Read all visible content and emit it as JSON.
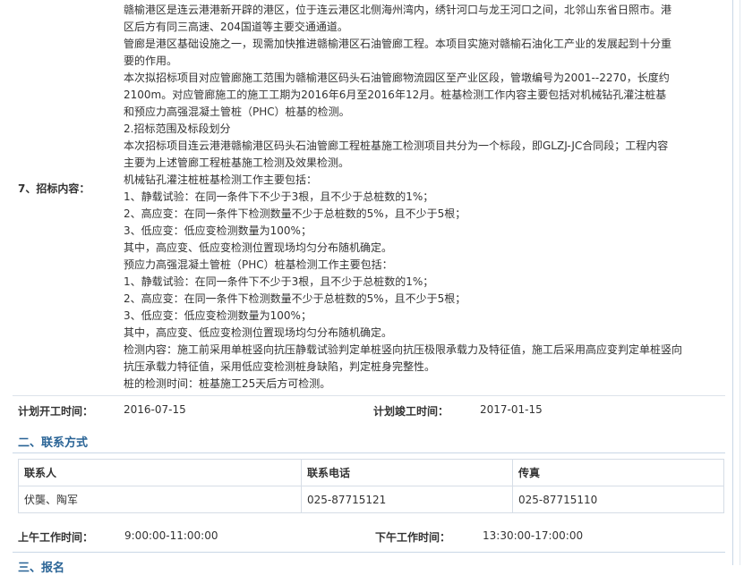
{
  "content": {
    "label": "7、招标内容：",
    "lines": [
      "赣榆港区是连云港港新开辟的港区，位于连云港区北侧海州湾内，绣针河口与龙王河口之间，北邻山东省日照市。港",
      "区后方有同三高速、204国道等主要交通通道。",
      "管廊是港区基础设施之一，现需加快推进赣榆港区石油管廊工程。本项目实施对赣榆石油化工产业的发展起到十分重",
      "要的作用。",
      "本次拟招标项目对应管廊施工范围为赣榆港区码头石油管廊物流园区至产业区段，管墩编号为2001--2270，长度约",
      "2100m。对应管廊施工的施工工期为2016年6月至2016年12月。桩基检测工作内容主要包括对机械钻孔灌注桩基",
      "和预应力高强混凝土管桩（PHC）桩基的检测。",
      "2.招标范围及标段划分",
      "本次招标项目连云港港赣榆港区码头石油管廊工程桩基施工检测项目共分为一个标段，即GLZJ-JC合同段；工程内容",
      "主要为上述管廊工程桩基施工检测及效果检测。",
      "机械钻孔灌注桩桩基检测工作主要包括：",
      "1、静载试验：在同一条件下不少于3根，且不少于总桩数的1%；",
      "2、高应变：在同一条件下检测数量不少于总桩数的5%，且不少于5根；",
      "3、低应变：低应变检测数量为100%；",
      "其中，高应变、低应变检测位置现场均匀分布随机确定。",
      "预应力高强混凝土管桩（PHC）桩基检测工作主要包括：",
      "1、静载试验：在同一条件下不少于3根，且不少于总桩数的1%；",
      "2、高应变：在同一条件下检测数量不少于总桩数的5%，且不少于5根；",
      "3、低应变：低应变检测数量为100%；",
      "其中，高应变、低应变检测位置现场均匀分布随机确定。",
      "检测内容：施工前采用单桩竖向抗压静载试验判定单桩竖向抗压极限承载力及特征值，施工后采用高应变判定单桩竖向",
      "抗压承载力特征值，采用低应变检测桩身缺陷，判定桩身完整性。",
      "桩的检测时间：桩基施工25天后方可检测。"
    ]
  },
  "plan": {
    "start_label": "计划开工时间：",
    "start_value": "2016-07-15",
    "end_label": "计划竣工时间：",
    "end_value": "2017-01-15"
  },
  "contact_section": {
    "title": "二、联系方式",
    "headers": [
      "联系人",
      "联系电话",
      "传真"
    ],
    "row": [
      "伏龑、陶军",
      "025-87715121",
      "025-87715110"
    ]
  },
  "hours": {
    "am_label": "上午工作时间：",
    "am_value": "9:00:00-11:00:00",
    "pm_label": "下午工作时间：",
    "pm_value": "13:30:00-17:00:00"
  },
  "next_section": {
    "title": "三、报名"
  }
}
